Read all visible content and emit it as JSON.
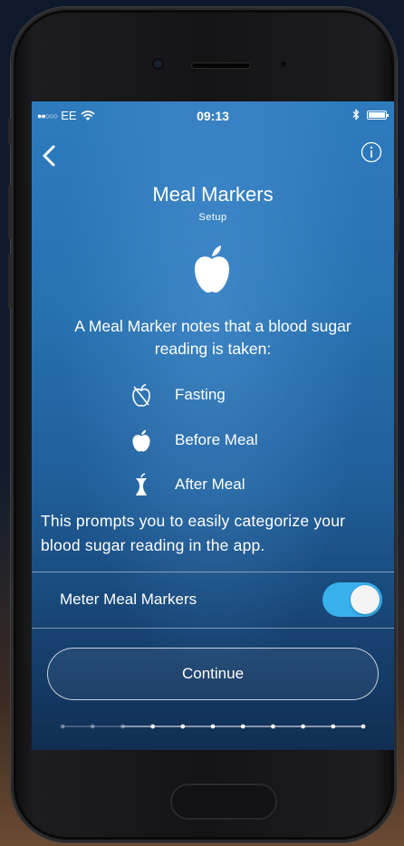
{
  "status_bar": {
    "signal": "●●○○○",
    "carrier": "EE",
    "time": "09:13"
  },
  "header": {
    "title": "Meal Markers",
    "subtitle": "Setup"
  },
  "description": "A Meal Marker notes that a blood sugar reading is taken:",
  "markers": [
    {
      "label": "Fasting",
      "icon": "apple-outline-icon"
    },
    {
      "label": "Before Meal",
      "icon": "apple-icon"
    },
    {
      "label": "After Meal",
      "icon": "apple-core-icon"
    }
  ],
  "prompt": "This prompts you to easily categorize your blood sugar reading in the app.",
  "setting": {
    "label": "Meter Meal Markers",
    "enabled": true
  },
  "continue_label": "Continue",
  "progress": {
    "total_steps": 11,
    "completed_steps": 3
  },
  "colors": {
    "toggle_on": "#39b0ee",
    "background_top": "#2e7bbd",
    "background_bottom": "#102e52"
  }
}
